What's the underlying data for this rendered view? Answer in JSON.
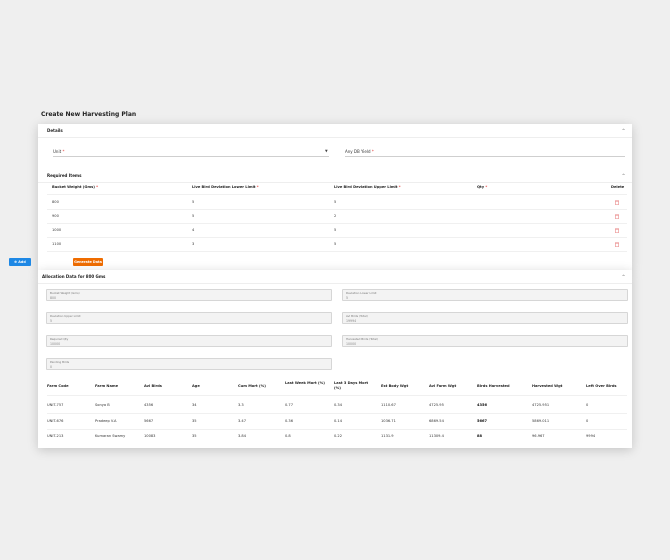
{
  "page": {
    "title": "Create New Harvesting Plan"
  },
  "details": {
    "title": "Details",
    "unit_label": "Unit",
    "any_db_label": "Any DB Yield",
    "req_mark": "*"
  },
  "required_items": {
    "title": "Required Items",
    "columns": [
      "Bucket Weight (Gms)",
      "Live Bird Deviation Lower Limit",
      "Live Bird Deviation Upper Limit",
      "Qty",
      "Delete"
    ],
    "rows": [
      {
        "bucket": "800",
        "lower": "5",
        "upper": "5"
      },
      {
        "bucket": "900",
        "lower": "5",
        "upper": "2"
      },
      {
        "bucket": "1000",
        "lower": "4",
        "upper": "5"
      },
      {
        "bucket": "1100",
        "lower": "3",
        "upper": "5"
      }
    ],
    "add_button": "Add",
    "generate_button": "Generate Data"
  },
  "allocation": {
    "title": "Allocation Data for 800 Gms",
    "fields": [
      {
        "label": "Bucket Weight (Gms)",
        "value": "800"
      },
      {
        "label": "Deviation Lower Limit",
        "value": "5"
      },
      {
        "label": "Deviation Upper Limit",
        "value": "5"
      },
      {
        "label": "Avl Birds (Total)",
        "value": "19994"
      },
      {
        "label": "Required Qty",
        "value": "10000"
      },
      {
        "label": "Harvested Birds (Total)",
        "value": "10000"
      },
      {
        "label": "Pending Birds",
        "value": "0"
      }
    ],
    "columns": [
      "Farm Code",
      "Farm Name",
      "Avl Birds",
      "Age",
      "Cum Mort (%)",
      "Last Week Mort (%)",
      "Last 3 Days Mort (%)",
      "Est Body Wgt",
      "Avl Farm Wgt",
      "Birds Harvested",
      "Harvested Wgt",
      "Left Over Birds"
    ],
    "rows": [
      [
        "UNIT-757",
        "Sonya B",
        "4356",
        "34",
        "3.3",
        "0.77",
        "0.34",
        "1110.67",
        "4725.95",
        "4356",
        "4725.951",
        "0"
      ],
      [
        "UNIT-676",
        "Pradeep V.A",
        "5667",
        "35",
        "3.47",
        "0.36",
        "0.14",
        "1036.71",
        "6869.54",
        "5667",
        "5869.011",
        "0"
      ],
      [
        "UNIT-213",
        "Kumaran Swamy",
        "10083",
        "35",
        "3.84",
        "0.8",
        "0.22",
        "1131.9",
        "11309.4",
        "88",
        "96.967",
        "9994"
      ]
    ]
  }
}
